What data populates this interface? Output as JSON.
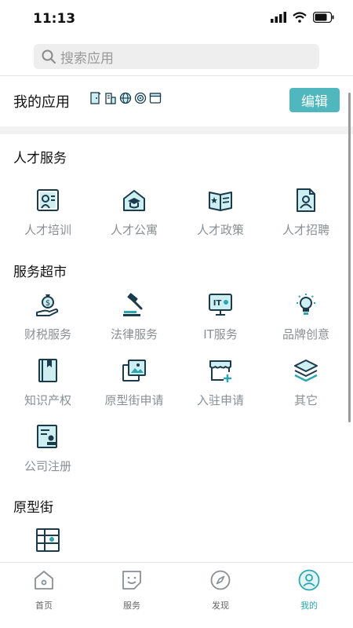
{
  "status_bar": {
    "time": "11:13"
  },
  "search": {
    "placeholder": "搜索应用"
  },
  "my_apps": {
    "title": "我的应用",
    "edit_label": "编辑"
  },
  "sections": [
    {
      "title": "人才服务",
      "items": [
        "人才培训",
        "人才公寓",
        "人才政策",
        "人才招聘"
      ]
    },
    {
      "title": "服务超市",
      "items": [
        "财税服务",
        "法律服务",
        "IT服务",
        "品牌创意",
        "知识产权",
        "原型街申请",
        "入驻申请",
        "其它",
        "公司注册"
      ]
    },
    {
      "title": "原型街",
      "items": [
        ""
      ]
    }
  ],
  "tabbar": [
    {
      "label": "首页",
      "icon": "home-icon"
    },
    {
      "label": "服务",
      "icon": "smile-icon"
    },
    {
      "label": "发现",
      "icon": "compass-icon"
    },
    {
      "label": "我的",
      "icon": "profile-icon",
      "active": true
    }
  ],
  "colors": {
    "accent": "#4fb7bd",
    "icon_dark": "#1b3a4b",
    "icon_teal": "#2aa7b0"
  }
}
